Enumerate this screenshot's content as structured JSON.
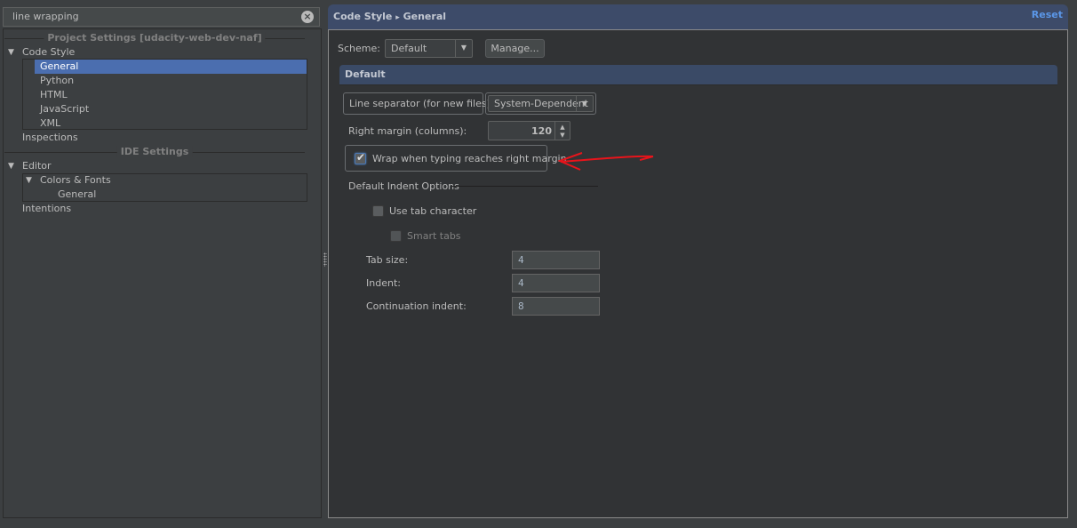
{
  "search": {
    "value": "line wrapping",
    "clear_icon": "clear-search-icon"
  },
  "tree": {
    "project_section": "Project Settings [udacity-web-dev-naf]",
    "code_style": "Code Style",
    "code_style_children": [
      "General",
      "Python",
      "HTML",
      "JavaScript",
      "XML"
    ],
    "selected": "General",
    "inspections": "Inspections",
    "ide_section": "IDE Settings",
    "editor": "Editor",
    "colors_fonts": "Colors & Fonts",
    "colors_fonts_child": "General",
    "intentions": "Intentions"
  },
  "header": {
    "breadcrumb_parent": "Code Style",
    "breadcrumb_sep": "▸",
    "breadcrumb_current": "General",
    "reset_label": "Reset"
  },
  "scheme": {
    "label": "Scheme:",
    "value": "Default",
    "manage_label": "Manage..."
  },
  "section_title": "Default",
  "line_separator": {
    "label": "Line separator (for new files):",
    "value": "System-Dependent"
  },
  "right_margin": {
    "label": "Right margin (columns):",
    "value": "120"
  },
  "wrap_checkbox": {
    "label": "Wrap when typing reaches right margin",
    "checked": true
  },
  "indent_options": {
    "title": "Default Indent Options",
    "use_tab_character": {
      "label": "Use tab character",
      "checked": false
    },
    "smart_tabs": {
      "label": "Smart tabs",
      "checked": false,
      "enabled": false
    },
    "tab_size": {
      "label": "Tab size:",
      "value": "4"
    },
    "indent": {
      "label": "Indent:",
      "value": "4"
    },
    "continuation_indent": {
      "label": "Continuation indent:",
      "value": "8"
    }
  },
  "annotation": {
    "color": "#e8141b",
    "meaning": "arrow pointing at wrap checkbox"
  }
}
